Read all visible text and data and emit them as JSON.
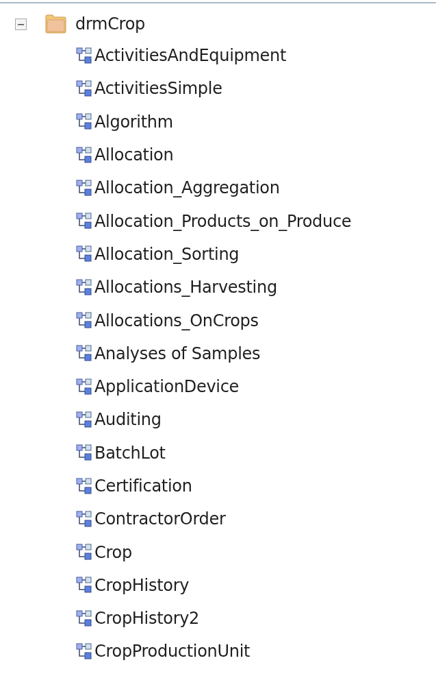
{
  "tree": {
    "label": "drmCrop",
    "expanded": true,
    "children": [
      {
        "label": "ActivitiesAndEquipment"
      },
      {
        "label": "ActivitiesSimple"
      },
      {
        "label": "Algorithm"
      },
      {
        "label": "Allocation"
      },
      {
        "label": "Allocation_Aggregation"
      },
      {
        "label": "Allocation_Products_on_Produce"
      },
      {
        "label": "Allocation_Sorting"
      },
      {
        "label": "Allocations_Harvesting"
      },
      {
        "label": "Allocations_OnCrops"
      },
      {
        "label": "Analyses of Samples"
      },
      {
        "label": "ApplicationDevice"
      },
      {
        "label": "Auditing"
      },
      {
        "label": "BatchLot"
      },
      {
        "label": "Certification"
      },
      {
        "label": "ContractorOrder"
      },
      {
        "label": "Crop"
      },
      {
        "label": "CropHistory"
      },
      {
        "label": "CropHistory2"
      },
      {
        "label": "CropProductionUnit"
      }
    ]
  }
}
